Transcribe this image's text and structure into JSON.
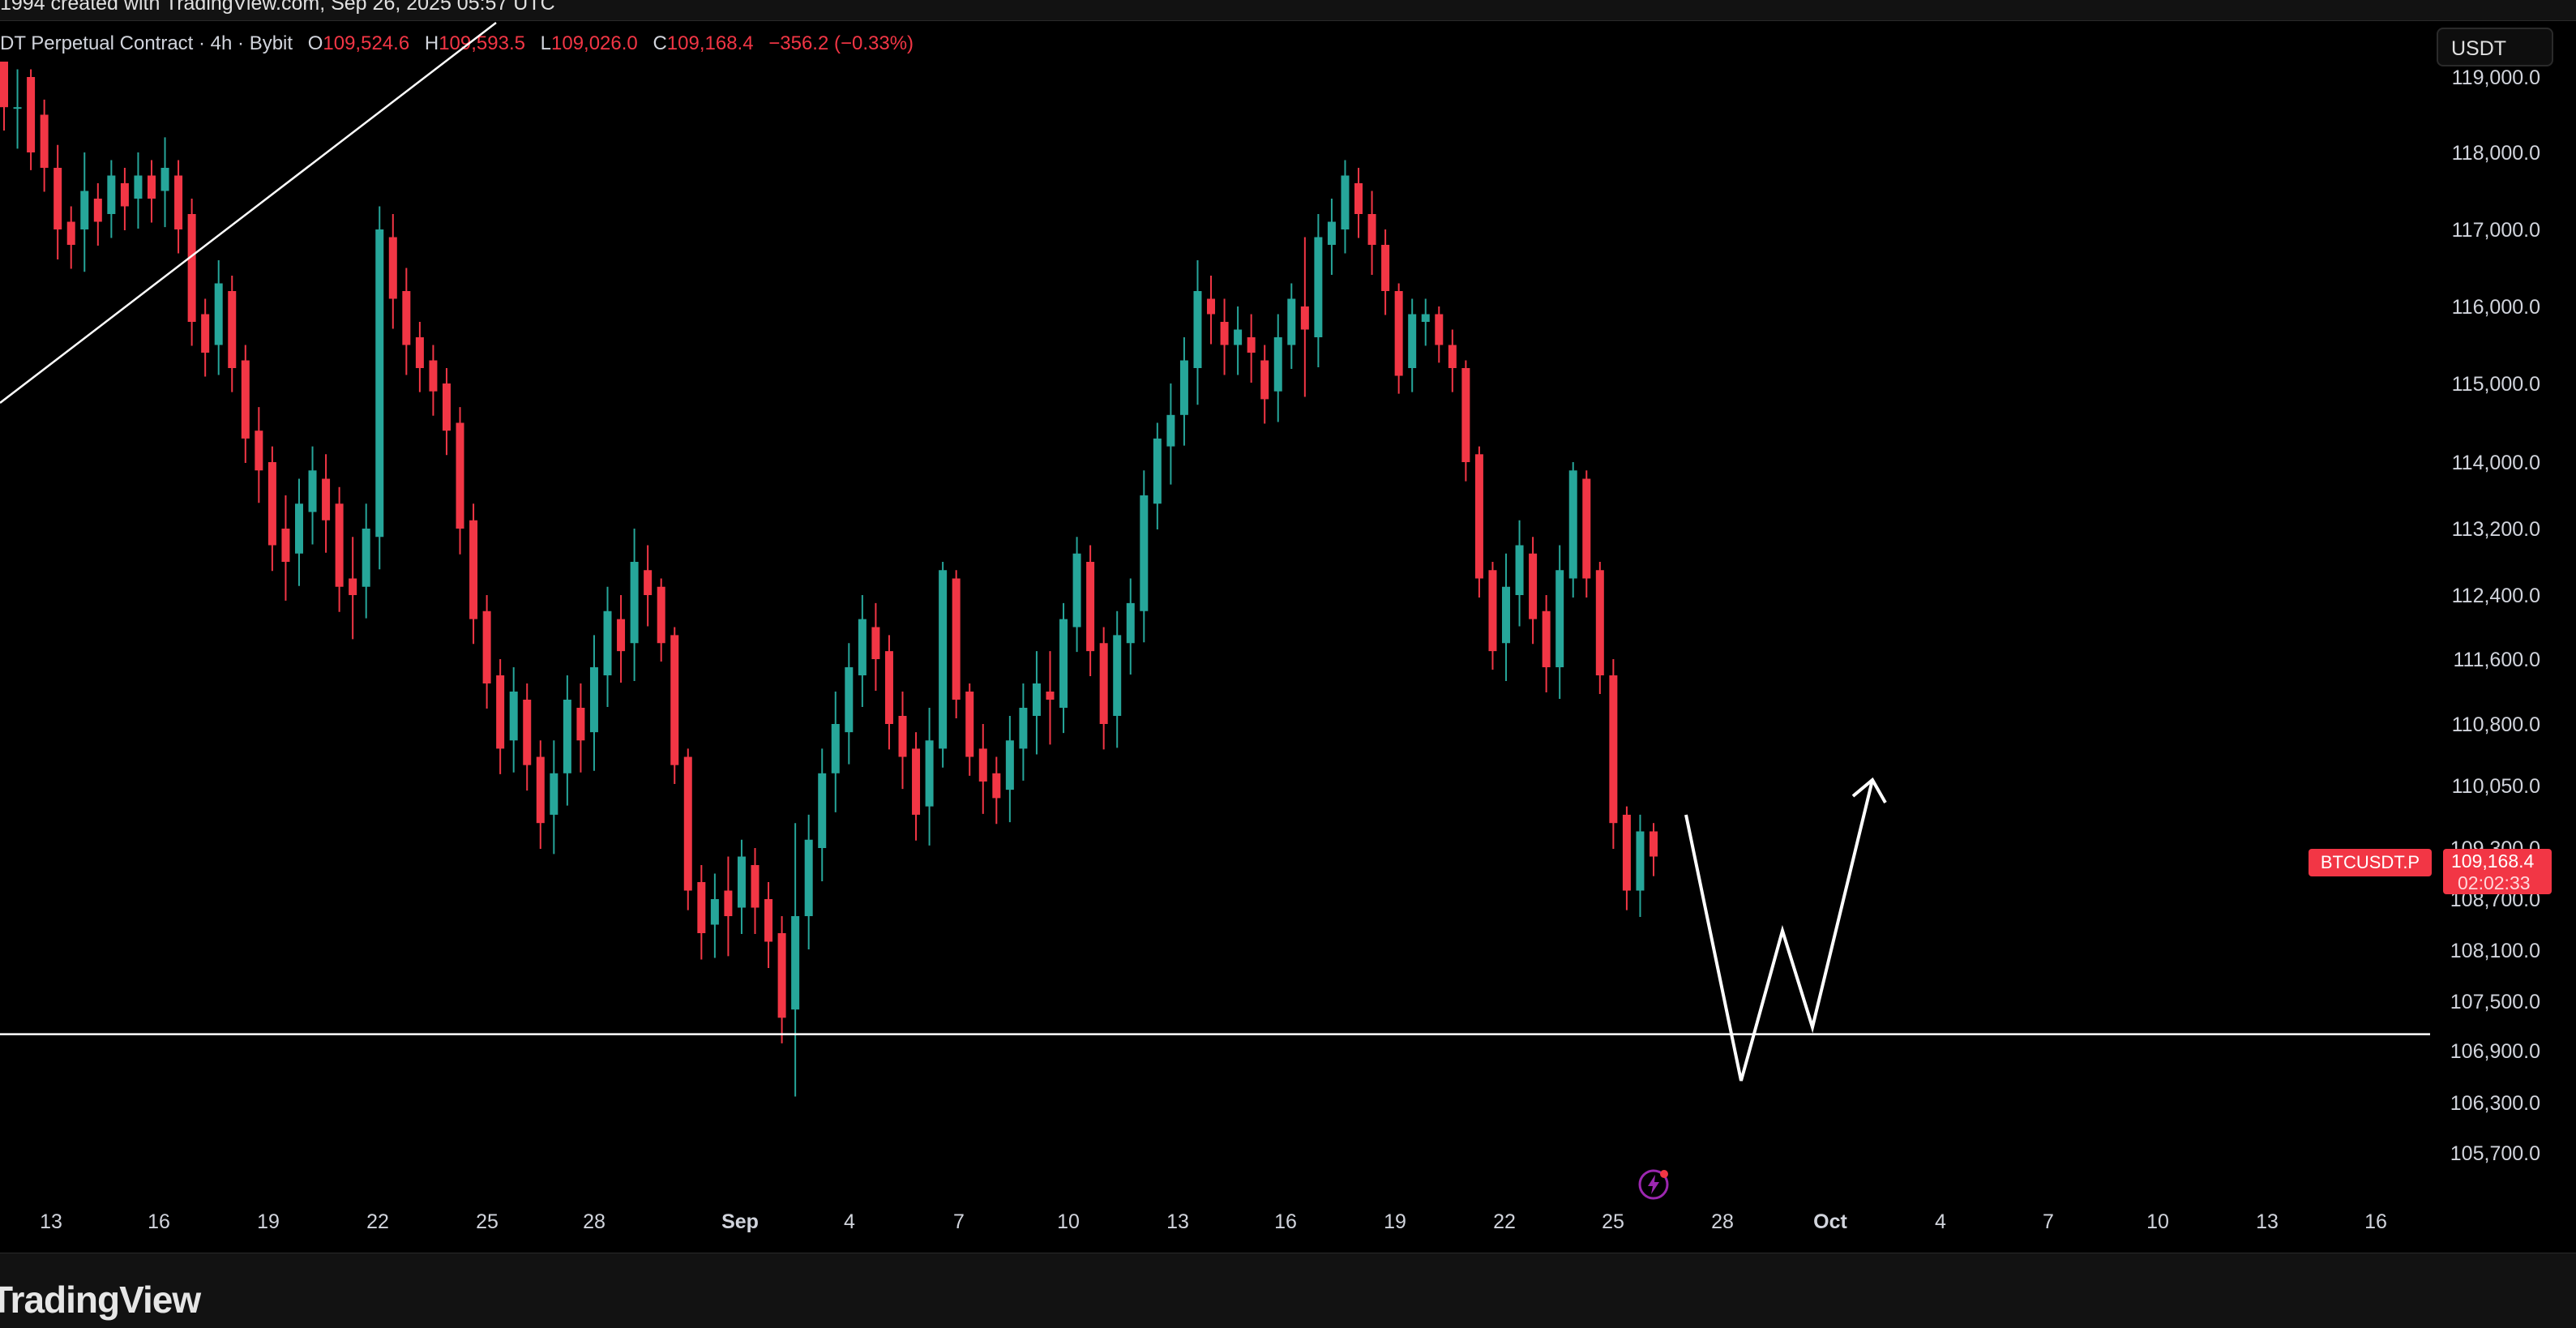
{
  "header": {
    "created_text": "1994 created with TradingView.com, Sep 26, 2025 05:57 UTC"
  },
  "symbol": {
    "description": "DT Perpetual Contract · 4h · Bybit",
    "o_label": "O",
    "o_value": "109,524.6",
    "h_label": "H",
    "h_value": "109,593.5",
    "l_label": "L",
    "l_value": "109,026.0",
    "c_label": "C",
    "c_value": "109,168.4",
    "change": "−356.2 (−0.33%)"
  },
  "currency_button": "USDT",
  "price_tag": {
    "symbol": "BTCUSDT.P",
    "price": "109,168.4",
    "countdown": "02:02:33"
  },
  "brand": "TradingView",
  "colors": {
    "up": "#26a69a",
    "down": "#f23645",
    "background": "#000000",
    "drawing": "#ffffff",
    "alert": "#e040fb"
  },
  "icons": {
    "alert": "lightning-alert-icon"
  },
  "chart_data": {
    "type": "candlestick",
    "timeframe": "4h",
    "y_axis": {
      "ticks": [
        "119,000.0",
        "118,000.0",
        "117,000.0",
        "116,000.0",
        "115,000.0",
        "114,000.0",
        "113,200.0",
        "112,400.0",
        "111,600.0",
        "110,800.0",
        "110,050.0",
        "109,300.0",
        "108,700.0",
        "108,100.0",
        "107,500.0",
        "106,900.0",
        "106,300.0",
        "105,700.0"
      ],
      "values": [
        119000,
        118000,
        117000,
        116000,
        115000,
        114000,
        113200,
        112400,
        111600,
        110800,
        110050,
        109300,
        108700,
        108100,
        107500,
        106900,
        106300,
        105700
      ]
    },
    "x_axis": {
      "ticks": [
        "13",
        "16",
        "19",
        "22",
        "25",
        "28",
        "Sep",
        "4",
        "7",
        "10",
        "13",
        "16",
        "19",
        "22",
        "25",
        "28",
        "Oct",
        "4",
        "7",
        "10",
        "13",
        "16"
      ],
      "bold": [
        "Sep",
        "Oct"
      ]
    },
    "path_points": [
      [
        119200,
        118600,
        119000
      ],
      [
        118600,
        118600,
        119100
      ],
      [
        119000,
        118000,
        119100
      ],
      [
        118500,
        117800,
        118700
      ],
      [
        117800,
        117000,
        118100
      ],
      [
        117100,
        116800,
        117300
      ],
      [
        117000,
        117500,
        118000
      ],
      [
        117400,
        117100,
        117600
      ],
      [
        117200,
        117700,
        117900
      ],
      [
        117600,
        117300,
        117800
      ],
      [
        117400,
        117700,
        118000
      ],
      [
        117700,
        117400,
        117900
      ],
      [
        117500,
        117800,
        118200
      ],
      [
        117700,
        117000,
        117900
      ],
      [
        117200,
        115800,
        117400
      ],
      [
        115900,
        115400,
        116100
      ],
      [
        115500,
        116300,
        116600
      ],
      [
        116200,
        115200,
        116400
      ],
      [
        115300,
        114300,
        115500
      ],
      [
        114400,
        113900,
        114700
      ],
      [
        114000,
        113000,
        114200
      ],
      [
        113200,
        112800,
        113600
      ],
      [
        112900,
        113500,
        113800
      ],
      [
        113400,
        113900,
        114200
      ],
      [
        113800,
        113300,
        114100
      ],
      [
        113500,
        112500,
        113700
      ],
      [
        112600,
        112400,
        113100
      ],
      [
        112500,
        113200,
        113500
      ],
      [
        113100,
        117000,
        117300
      ],
      [
        116900,
        116100,
        117200
      ],
      [
        116200,
        115500,
        116500
      ],
      [
        115600,
        115200,
        115800
      ],
      [
        115300,
        114900,
        115500
      ],
      [
        115000,
        114400,
        115200
      ],
      [
        114500,
        113200,
        114700
      ],
      [
        113300,
        112100,
        113500
      ],
      [
        112200,
        111300,
        112400
      ],
      [
        111400,
        110500,
        111600
      ],
      [
        110600,
        111200,
        111500
      ],
      [
        111100,
        110300,
        111300
      ],
      [
        110400,
        109600,
        110600
      ],
      [
        109700,
        110200,
        110600
      ],
      [
        110200,
        111100,
        111400
      ],
      [
        111000,
        110600,
        111300
      ],
      [
        110700,
        111500,
        111900
      ],
      [
        111400,
        112200,
        112500
      ],
      [
        112100,
        111700,
        112400
      ],
      [
        111800,
        112800,
        113200
      ],
      [
        112700,
        112400,
        113000
      ],
      [
        112500,
        111800,
        112600
      ],
      [
        111900,
        110300,
        112000
      ],
      [
        110400,
        108800,
        110500
      ],
      [
        108900,
        108300,
        109100
      ],
      [
        108400,
        108700,
        109000
      ],
      [
        108800,
        108500,
        109200
      ],
      [
        108600,
        109200,
        109400
      ],
      [
        109100,
        108600,
        109300
      ],
      [
        108700,
        108200,
        108900
      ],
      [
        108300,
        107300,
        108500
      ],
      [
        107400,
        108500,
        109600
      ],
      [
        108500,
        109400,
        109700
      ],
      [
        109300,
        110200,
        110500
      ],
      [
        110200,
        110800,
        111200
      ],
      [
        110700,
        111500,
        111800
      ],
      [
        111400,
        112100,
        112400
      ],
      [
        112000,
        111600,
        112300
      ],
      [
        111700,
        110800,
        111900
      ],
      [
        110900,
        110400,
        111200
      ],
      [
        110500,
        109700,
        110700
      ],
      [
        109800,
        110600,
        111000
      ],
      [
        110500,
        112700,
        112800
      ],
      [
        112600,
        111100,
        112700
      ],
      [
        111200,
        110400,
        111300
      ],
      [
        110500,
        110100,
        110800
      ],
      [
        110200,
        109900,
        110400
      ],
      [
        110000,
        110600,
        110900
      ],
      [
        110500,
        111000,
        111300
      ],
      [
        110900,
        111300,
        111700
      ],
      [
        111200,
        111100,
        111700
      ],
      [
        111000,
        112100,
        112300
      ],
      [
        112000,
        112900,
        113100
      ],
      [
        112800,
        111700,
        113000
      ],
      [
        111800,
        110800,
        112000
      ],
      [
        110900,
        111900,
        112200
      ],
      [
        111800,
        112300,
        112600
      ],
      [
        112200,
        113600,
        113900
      ],
      [
        113500,
        114300,
        114500
      ],
      [
        114200,
        114600,
        115000
      ],
      [
        114600,
        115300,
        115600
      ],
      [
        115200,
        116200,
        116600
      ],
      [
        116100,
        115900,
        116400
      ],
      [
        115800,
        115500,
        116100
      ],
      [
        115500,
        115700,
        116000
      ],
      [
        115600,
        115400,
        115900
      ],
      [
        115300,
        114800,
        115500
      ],
      [
        114900,
        115600,
        115900
      ],
      [
        115500,
        116100,
        116300
      ],
      [
        116000,
        115700,
        116900
      ],
      [
        115600,
        116900,
        117200
      ],
      [
        116800,
        117100,
        117400
      ],
      [
        117000,
        117700,
        117900
      ],
      [
        117600,
        117200,
        117800
      ],
      [
        117200,
        116800,
        117500
      ],
      [
        116800,
        116200,
        117000
      ],
      [
        116200,
        115100,
        116300
      ],
      [
        115200,
        115900,
        116100
      ],
      [
        115800,
        115900,
        116100
      ],
      [
        115900,
        115500,
        116000
      ],
      [
        115500,
        115200,
        115700
      ],
      [
        115200,
        114000,
        115300
      ],
      [
        114100,
        112600,
        114200
      ],
      [
        112700,
        111700,
        112800
      ],
      [
        111800,
        112500,
        112900
      ],
      [
        112400,
        113000,
        113300
      ],
      [
        112900,
        112100,
        113100
      ],
      [
        112200,
        111500,
        112400
      ],
      [
        111500,
        112700,
        113000
      ],
      [
        112600,
        113900,
        114000
      ],
      [
        113800,
        112600,
        113900
      ],
      [
        112700,
        111400,
        112800
      ],
      [
        111400,
        109600,
        111600
      ],
      [
        109700,
        108800,
        109800
      ],
      [
        108800,
        109500,
        109700
      ],
      [
        109500,
        109200,
        109600
      ]
    ],
    "prediction_path": [
      [
        109800,
        "27"
      ],
      [
        106600,
        "29"
      ],
      [
        107300,
        "30"
      ],
      [
        109500,
        "Oct"
      ],
      [
        110300,
        "Oct+0.5"
      ]
    ],
    "horizontal_line": 107100,
    "last_price": 109168.4
  }
}
